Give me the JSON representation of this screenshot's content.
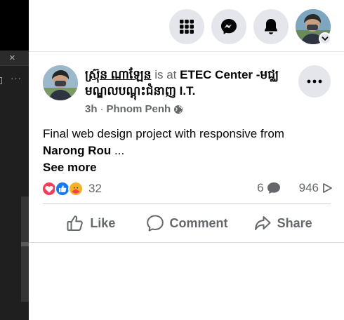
{
  "post": {
    "author": "ស្រ៊ុន ណាឡែន",
    "is_at": "is at",
    "place": "ETEC Center -មជ្ឈមណ្ឌលបណ្តុះជំនាញ I.T.",
    "time": "3h",
    "separator": "·",
    "location": "Phnom Penh",
    "text": "Final web design project with responsive from",
    "mention": "Narong Rou",
    "ellipsis": " ...",
    "see_more": "See more",
    "reaction_count": "32",
    "comment_count": "6",
    "share_count": "946"
  },
  "actions": {
    "like": "Like",
    "comment": "Comment",
    "share": "Share"
  },
  "left_pane": {
    "close": "×",
    "more": "···"
  },
  "colors": {
    "nav_button_bg": "#e4e6eb",
    "text_primary": "#050505",
    "text_secondary": "#65676b",
    "love": "#f33e58",
    "like": "#1877f2",
    "care": "#f7b125"
  },
  "icons": {
    "menu": "grid-menu-icon",
    "messenger": "messenger-icon",
    "notifications": "bell-icon",
    "account_caret": "chevron-down-icon",
    "post_more": "more-horizontal-icon",
    "privacy": "globe-icon",
    "comments": "comment-bubble-icon",
    "shares": "share-arrow-icon"
  }
}
